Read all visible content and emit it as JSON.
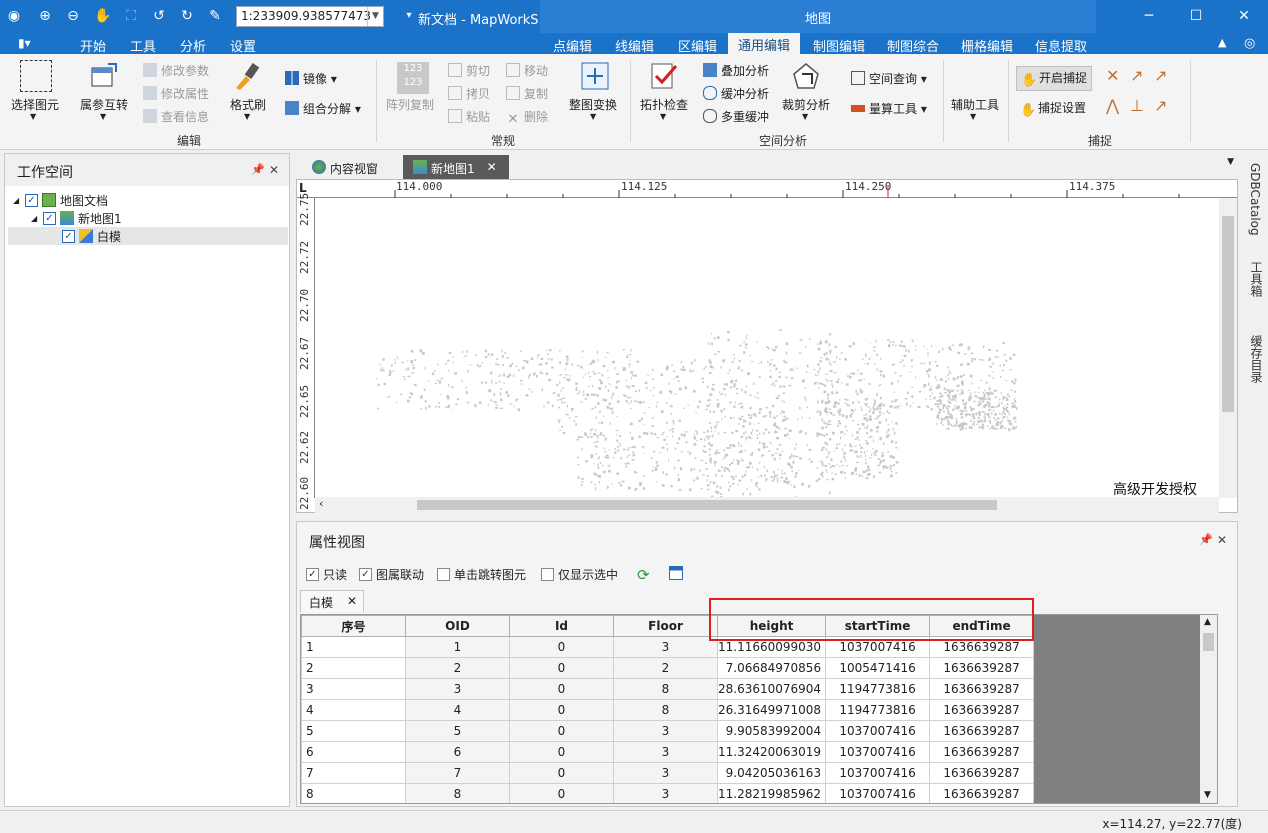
{
  "titlebar": {
    "scale_value": "1:233909.938577473",
    "doc_title": "新文档 - MapWorkS...",
    "context_title": "地图",
    "minimize": "─",
    "maximize": "☐",
    "close": "✕"
  },
  "ribbon_tabs": {
    "file_menu": "▮▾",
    "items": [
      "开始",
      "工具",
      "分析",
      "设置"
    ],
    "context_items": [
      "点编辑",
      "线编辑",
      "区编辑",
      "通用编辑",
      "制图编辑",
      "制图综合",
      "栅格编辑",
      "信息提取"
    ],
    "active": "通用编辑"
  },
  "ribbon": {
    "edit_group": {
      "name": "编辑",
      "select_element": "选择图元",
      "attr_interchange": "属参互转",
      "modify_params": "修改参数",
      "modify_attrs": "修改属性",
      "view_info": "查看信息",
      "format_brush": "格式刷",
      "mirror": "镜像",
      "combine_split": "组合分解"
    },
    "common_group": {
      "name": "常规",
      "array_copy": "阵列复制",
      "cut": "剪切",
      "copy": "拷贝",
      "paste": "粘贴",
      "move": "移动",
      "duplicate": "复制",
      "delete": "删除",
      "array_icon_text": "123"
    },
    "spatial_group": {
      "name": "空间分析",
      "whole_transform": "整图变换",
      "topo_check": "拓扑检查",
      "overlay": "叠加分析",
      "buffer": "缓冲分析",
      "multi_buffer": "多重缓冲",
      "clip": "裁剪分析",
      "spatial_query": "空间查询",
      "measure": "量算工具",
      "assist": "辅助工具"
    },
    "snap_group": {
      "name": "捕捉",
      "start_snap": "开启捕捉",
      "snap_settings": "捕捉设置"
    }
  },
  "workspace": {
    "title": "工作空间",
    "tree": [
      {
        "label": "地图文档",
        "checked": true
      },
      {
        "label": "新地图1",
        "checked": true
      },
      {
        "label": "白模",
        "checked": true
      }
    ]
  },
  "doc_tabs": [
    {
      "label": "内容视窗"
    },
    {
      "label": "新地图1"
    }
  ],
  "map": {
    "ruler_corner": "L",
    "x_ticks": [
      "114.000",
      "114.125",
      "114.250",
      "114.375"
    ],
    "y_ticks": [
      "22.75",
      "22.72",
      "22.70",
      "22.67",
      "22.65",
      "22.62",
      "22.60"
    ],
    "watermark": "高级开发授权"
  },
  "attribute_view": {
    "title": "属性视图",
    "options": [
      {
        "label": "只读",
        "checked": true
      },
      {
        "label": "图属联动",
        "checked": true
      },
      {
        "label": "单击跳转图元",
        "checked": false
      },
      {
        "label": "仅显示选中",
        "checked": false
      }
    ],
    "layer_tab": "白模",
    "columns": [
      "序号",
      "OID",
      "Id",
      "Floor",
      "height",
      "startTime",
      "endTime"
    ],
    "rows": [
      [
        "1",
        "1",
        "0",
        "3",
        "11.11660099030",
        "1037007416",
        "1636639287"
      ],
      [
        "2",
        "2",
        "0",
        "2",
        "7.06684970856",
        "1005471416",
        "1636639287"
      ],
      [
        "3",
        "3",
        "0",
        "8",
        "28.63610076904",
        "1194773816",
        "1636639287"
      ],
      [
        "4",
        "4",
        "0",
        "8",
        "26.31649971008",
        "1194773816",
        "1636639287"
      ],
      [
        "5",
        "5",
        "0",
        "3",
        "9.90583992004",
        "1037007416",
        "1636639287"
      ],
      [
        "6",
        "6",
        "0",
        "3",
        "11.32420063019",
        "1037007416",
        "1636639287"
      ],
      [
        "7",
        "7",
        "0",
        "3",
        "9.04205036163",
        "1037007416",
        "1636639287"
      ],
      [
        "8",
        "8",
        "0",
        "3",
        "11.28219985962",
        "1037007416",
        "1636639287"
      ]
    ]
  },
  "right_rail": [
    "GDBCatalog",
    "工具箱",
    "缓存目录"
  ],
  "status": {
    "coords": "x=114.27, y=22.77(度)"
  },
  "colors": {
    "titlebar": "#1a73c8",
    "context_band": "#2a7fd4",
    "highlight": "#e02020"
  }
}
